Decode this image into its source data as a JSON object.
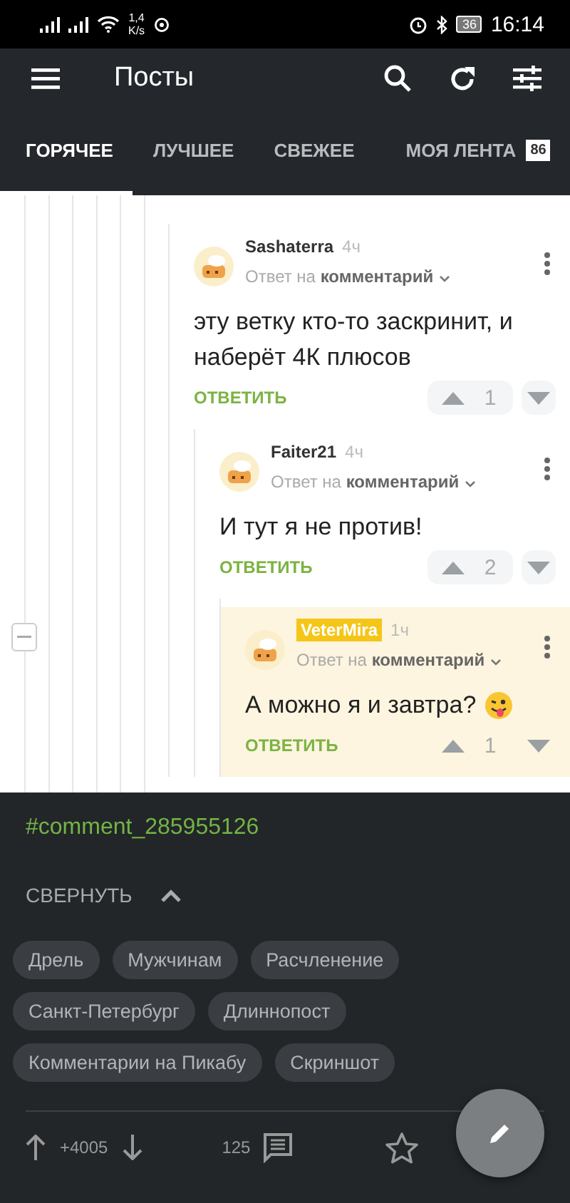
{
  "status_bar": {
    "speed_value": "1,4",
    "speed_unit": "K/s",
    "battery": "36",
    "time": "16:14"
  },
  "app_bar": {
    "title": "Посты"
  },
  "tabs": [
    {
      "label": "ГОРЯЧЕЕ",
      "selected": true
    },
    {
      "label": "ЛУЧШЕЕ",
      "selected": false
    },
    {
      "label": "СВЕЖЕЕ",
      "selected": false
    },
    {
      "label": "МОЯ ЛЕНТА",
      "selected": false,
      "badge": "86"
    }
  ],
  "comments": [
    {
      "author": "Sashaterra",
      "time": "4ч",
      "reply_prefix": "Ответ на",
      "reply_target": "комментарий",
      "text": "эту ветку кто-то заскринит, и наберёт 4К плюсов",
      "reply_label": "ОТВЕТИТЬ",
      "votes": "1",
      "highlighted": false,
      "emoji": false,
      "children": [
        {
          "author": "Faiter21",
          "time": "4ч",
          "reply_prefix": "Ответ на",
          "reply_target": "комментарий",
          "text": "И тут я не против!",
          "reply_label": "ОТВЕТИТЬ",
          "votes": "2",
          "highlighted": false,
          "emoji": false,
          "children": [
            {
              "author": "VeterMira",
              "time": "1ч",
              "reply_prefix": "Ответ на",
              "reply_target": "комментарий",
              "text": "А можно я и завтра?",
              "reply_label": "ОТВЕТИТЬ",
              "votes": "1",
              "highlighted": true,
              "emoji": true
            }
          ]
        }
      ]
    }
  ],
  "comment_link": "#comment_285955126",
  "collapse_label": "СВЕРНУТЬ",
  "tags": [
    "Дрель",
    "Мужчинам",
    "Расчленение",
    "Санкт-Петербург",
    "Длиннопост",
    "Комментарии на Пикабу",
    "Скриншот"
  ],
  "post_bar": {
    "rating": "+4005",
    "comments_count": "125"
  }
}
